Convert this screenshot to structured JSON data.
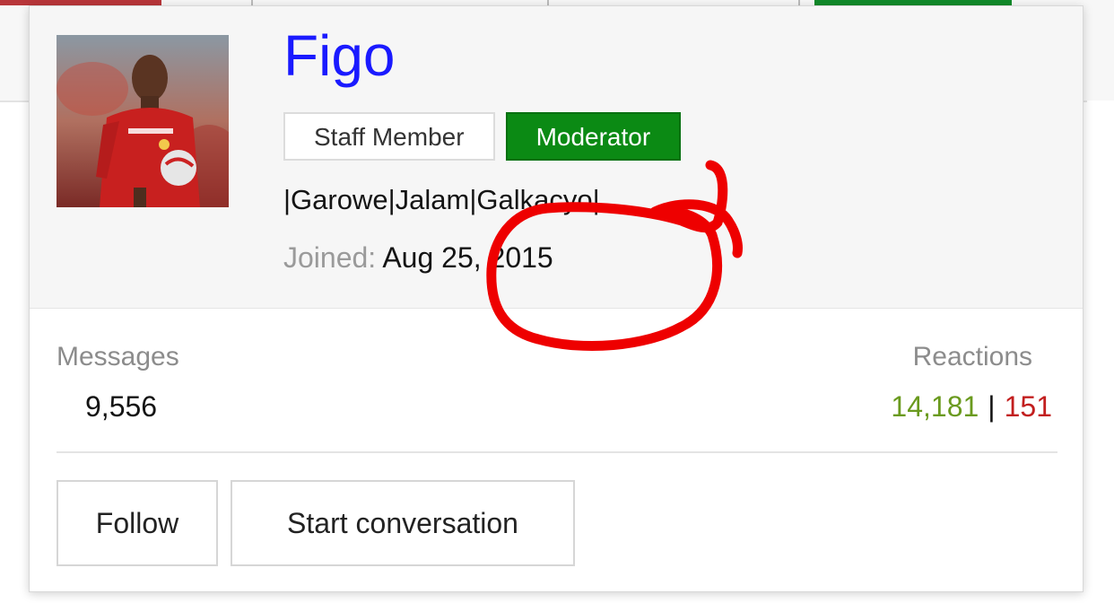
{
  "profile": {
    "username": "Figo",
    "badges": {
      "staff": "Staff Member",
      "moderator": "Moderator"
    },
    "custom_title": "|Garowe|Jalam|Galkacyo|",
    "joined_label": "Joined:",
    "joined_value": "Aug 25, 2015"
  },
  "stats": {
    "messages_label": "Messages",
    "messages_value": "9,556",
    "reactions_label": "Reactions",
    "reactions_positive": "14,181",
    "reactions_separator": "|",
    "reactions_negative": "151"
  },
  "actions": {
    "follow": "Follow",
    "start_conversation": "Start conversation"
  },
  "colors": {
    "username": "#1a1aff",
    "moderator_badge": "#0b8a14",
    "reactions_positive": "#6a9a1e",
    "reactions_negative": "#c21e1e",
    "annotation": "#ee0000"
  }
}
